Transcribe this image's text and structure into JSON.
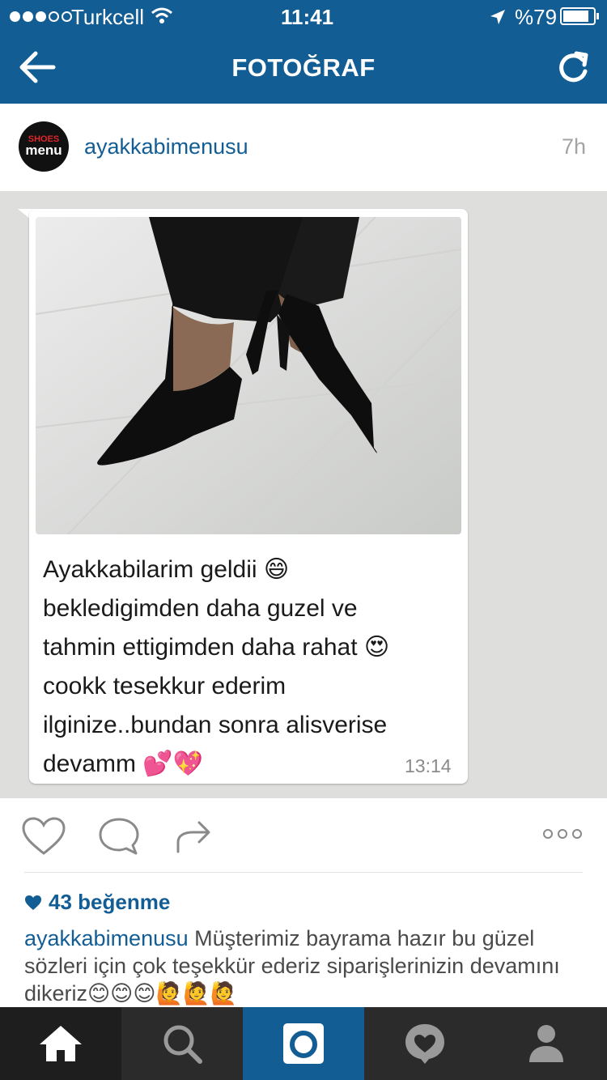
{
  "status_bar": {
    "carrier": "Turkcell",
    "time": "11:41",
    "battery": "%79",
    "signal_filled": 3,
    "signal_total": 5
  },
  "header": {
    "title": "FOTOĞRAF"
  },
  "post": {
    "username": "ayakkabimenusu",
    "age": "7h",
    "avatar_line1": "SHOES",
    "avatar_line2": "menu",
    "message_text": "Ayakkabilarim geldii 😄\nbekledigimden daha guzel ve\ntahmin ettigimden daha rahat 😍\ncookk tesekkur ederim\nilginize..bundan sonra alisverise\ndevamm 💕💖",
    "message_time": "13:14",
    "likes": "43 beğenme",
    "caption_user": "ayakkabimenusu",
    "caption_text": "Müşterimiz bayrama hazır bu güzel sözleri için çok teşekkür ederiz siparişlerinizin devamını dikeriz😊😊😊🙋🙋🙋"
  },
  "icons": {
    "back": "back-arrow-icon",
    "refresh": "refresh-icon",
    "like": "heart-icon",
    "comment": "comment-icon",
    "share": "share-icon",
    "more": "more-icon",
    "home": "home-icon",
    "search": "search-icon",
    "camera": "camera-icon",
    "activity": "activity-icon",
    "profile": "profile-icon"
  },
  "colors": {
    "brand": "#135d95",
    "tabbar": "#2b2b2b",
    "photo_bg": "#dededd"
  }
}
